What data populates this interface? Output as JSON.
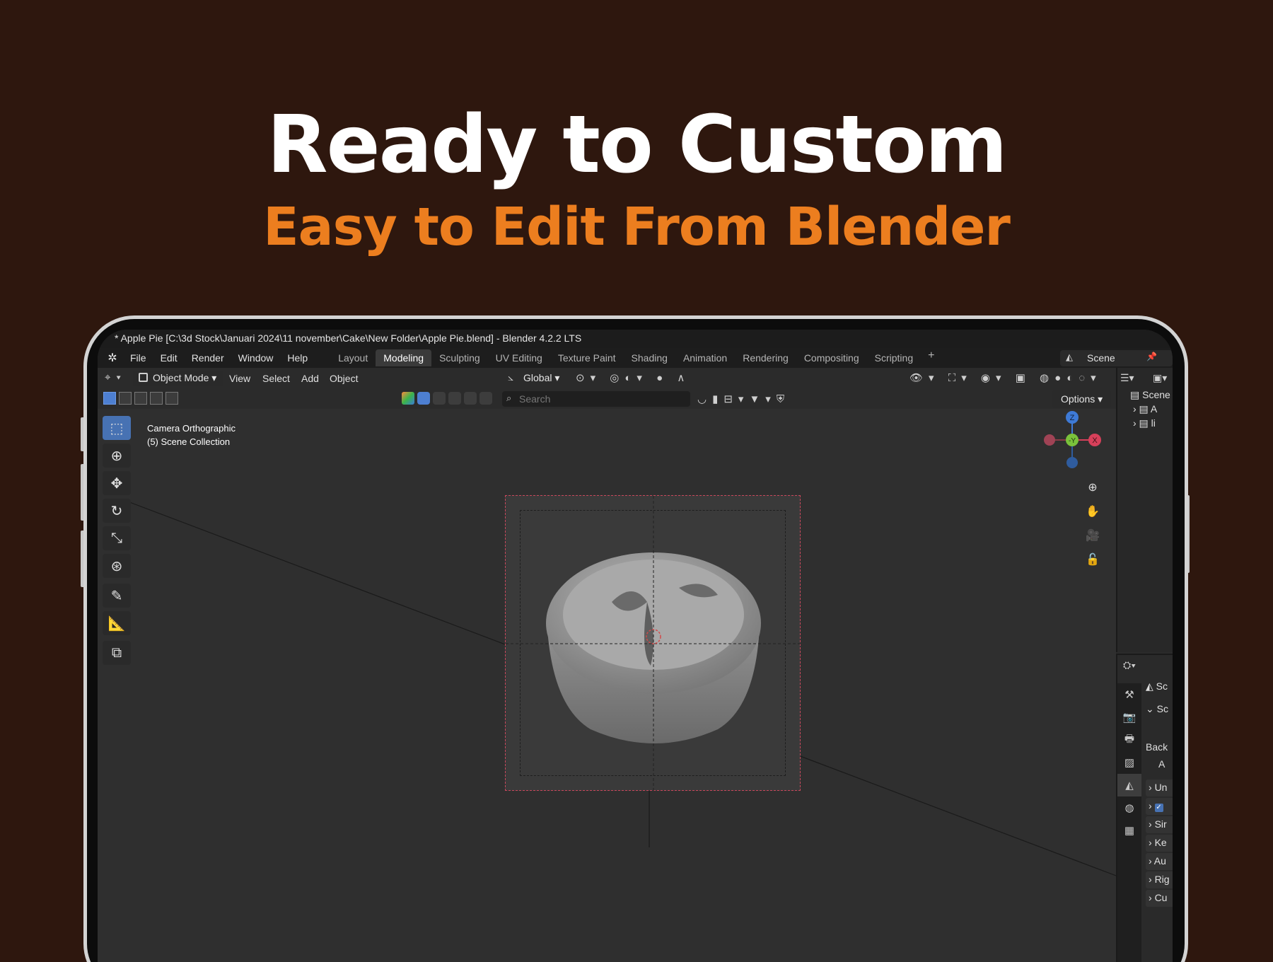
{
  "hero": {
    "title": "Ready to Custom",
    "subtitle": "Easy to Edit From Blender"
  },
  "window": {
    "title": "* Apple Pie [C:\\3d Stock\\Januari 2024\\11 november\\Cake\\New Folder\\Apple Pie.blend] - Blender 4.2.2 LTS"
  },
  "menu": {
    "items": [
      "File",
      "Edit",
      "Render",
      "Window",
      "Help"
    ]
  },
  "workspaces": {
    "tabs": [
      "Layout",
      "Modeling",
      "Sculpting",
      "UV Editing",
      "Texture Paint",
      "Shading",
      "Animation",
      "Rendering",
      "Compositing",
      "Scripting"
    ],
    "active": "Modeling",
    "add": "+"
  },
  "scene": {
    "name": "Scene"
  },
  "header": {
    "mode": "Object Mode",
    "menus": [
      "View",
      "Select",
      "Add",
      "Object"
    ],
    "orientation": "Global",
    "search_placeholder": "Search",
    "options": "Options"
  },
  "viewport": {
    "view_name": "Camera Orthographic",
    "collection": "(5) Scene Collection",
    "gizmo": {
      "z": "Z",
      "y": "-Y",
      "x": "X"
    }
  },
  "outliner": {
    "root": "Scene",
    "children": [
      "A",
      "li"
    ]
  },
  "properties": {
    "header": "Sc",
    "section": "Sc",
    "labels": [
      "Back",
      "A"
    ],
    "panels": [
      "Un",
      "",
      "Sir",
      "Ke",
      "Au",
      "Rig",
      "Cu"
    ]
  },
  "colors": {
    "background": "#2e170e",
    "accent": "#ec7e1f",
    "blender_active": "#4772b3"
  }
}
